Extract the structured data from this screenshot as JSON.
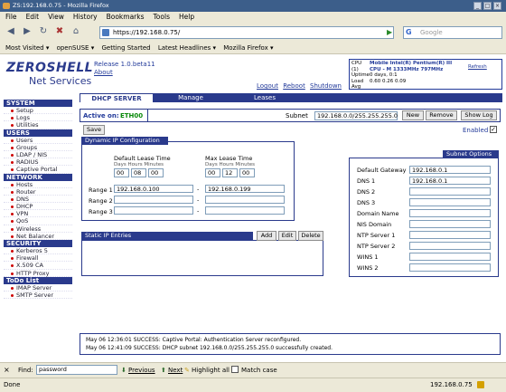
{
  "window": {
    "title": "ZS:192.168.0.75 - Mozilla Firefox"
  },
  "menu": [
    "File",
    "Edit",
    "View",
    "History",
    "Bookmarks",
    "Tools",
    "Help"
  ],
  "nav": {
    "url": "https://192.168.0.75/",
    "search_placeholder": "Google"
  },
  "bookmarks": [
    "Most Visited ▾",
    "openSUSE ▾",
    "Getting Started",
    "Latest Headlines ▾",
    "Mozilla Firefox ▾"
  ],
  "header": {
    "logo_line1": "ZEROSHELL",
    "logo_line2": "Net Services",
    "release": "Release 1.0.beta11",
    "about": "About",
    "links": [
      "Logout",
      "Reboot",
      "Shutdown"
    ],
    "cpu_label": "CPU (1)",
    "cpu_value": "Mobile Intel(R) Pentium(R) III CPU - M 1333MHz 797MHz",
    "uptime_label": "Uptime",
    "uptime_value": "0 days, 0:1",
    "load_label": "Load Avg",
    "load_value": "0.60 0.26 0.09",
    "refresh": "Refresh"
  },
  "sidebar": [
    {
      "title": "SYSTEM",
      "items": [
        "Setup",
        "Logs",
        "Utilities"
      ]
    },
    {
      "title": "USERS",
      "items": [
        "Users",
        "Groups",
        "LDAP / NIS",
        "RADIUS",
        "Captive Portal"
      ]
    },
    {
      "title": "NETWORK",
      "items": [
        "Hosts",
        "Router",
        "DNS",
        "DHCP",
        "VPN",
        "QoS",
        "Wireless",
        "Net Balancer"
      ]
    },
    {
      "title": "SECURITY",
      "items": [
        "Kerberos 5",
        "Firewall",
        "X.509 CA",
        "HTTP Proxy"
      ]
    },
    {
      "title": "ToDo List",
      "items": [
        "IMAP Server",
        "SMTP Server"
      ]
    }
  ],
  "tabs": [
    "DHCP SERVER",
    "Manage",
    "Leases"
  ],
  "active_bar": {
    "label": "Active on:",
    "iface": "ETH00",
    "subnet_label": "Subnet",
    "subnet_value": "192.168.0.0/255.255.255.0",
    "new": "New",
    "remove": "Remove",
    "show_log": "Show Log",
    "enabled_label": "Enabled"
  },
  "save": "Save",
  "dynamic": {
    "title": "Dynamic IP Configuration",
    "default_lease": "Default Lease Time",
    "max_lease": "Max Lease Time",
    "sub_labels": "Days  Hours Minutes",
    "default_values": [
      "00",
      "08",
      "00"
    ],
    "max_values": [
      "00",
      "12",
      "00"
    ],
    "ranges": [
      {
        "label": "Range 1",
        "from": "192.168.0.100",
        "to": "192.168.0.199"
      },
      {
        "label": "Range 2",
        "from": "",
        "to": ""
      },
      {
        "label": "Range 3",
        "from": "",
        "to": ""
      }
    ]
  },
  "static": {
    "title": "Static IP Entries",
    "add": "Add",
    "edit": "Edit",
    "delete": "Delete"
  },
  "subnet_options": {
    "title": "Subnet Options",
    "fields": [
      {
        "label": "Default Gateway",
        "value": "192.168.0.1"
      },
      {
        "label": "DNS 1",
        "value": "192.168.0.1"
      },
      {
        "label": "DNS 2",
        "value": ""
      },
      {
        "label": "DNS 3",
        "value": ""
      },
      {
        "label": "Domain Name",
        "value": ""
      },
      {
        "label": "NIS Domain",
        "value": ""
      },
      {
        "label": "NTP Server 1",
        "value": ""
      },
      {
        "label": "NTP Server 2",
        "value": ""
      },
      {
        "label": "WINS 1",
        "value": ""
      },
      {
        "label": "WINS 2",
        "value": ""
      }
    ]
  },
  "log": [
    "May 06 12:36:01 SUCCESS: Captive Portal: Authentication Server reconfigured.",
    "May 06 12:41:09 SUCCESS: DHCP subnet 192.168.0.0/255.255.255.0 successfully created."
  ],
  "find": {
    "label": "Find:",
    "value": "password",
    "previous": "Previous",
    "next": "Next",
    "highlight": "Highlight all",
    "match_case": "Match case"
  },
  "status": {
    "left": "Done",
    "right": "192.168.0.75"
  }
}
